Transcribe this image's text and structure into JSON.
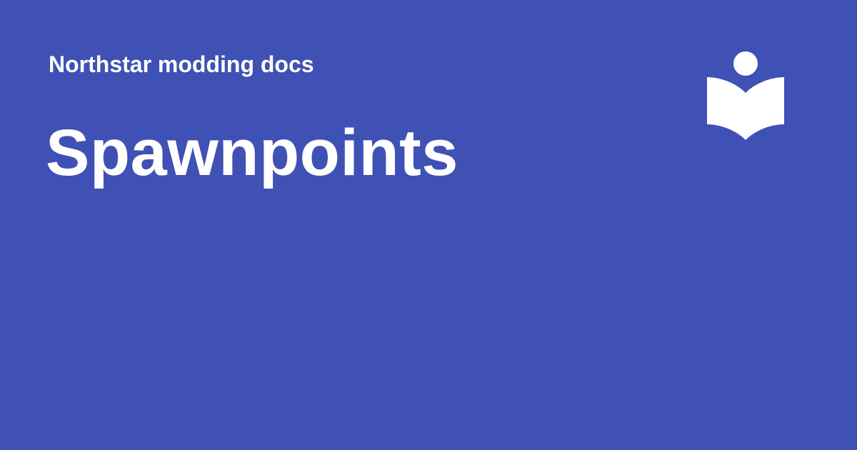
{
  "card": {
    "site_name": "Northstar modding docs",
    "page_title": "Spawnpoints",
    "logo_icon": "reader-book-icon",
    "background_color": "#3f51b5",
    "text_color": "#ffffff"
  }
}
